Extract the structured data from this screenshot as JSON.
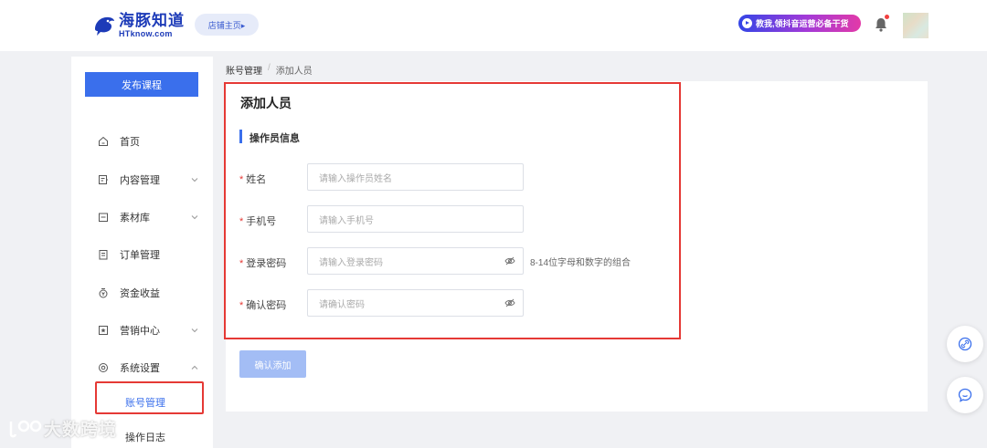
{
  "header": {
    "logo_cn": "海豚知道",
    "logo_en": "HTknow.com",
    "shop_button": "店铺主页▸",
    "promo_text": "教我,领抖音运营必备干货"
  },
  "sidebar": {
    "publish_button": "发布课程",
    "items": [
      {
        "label": "首页",
        "icon": "home-icon"
      },
      {
        "label": "内容管理",
        "icon": "content-icon"
      },
      {
        "label": "素材库",
        "icon": "folder-icon"
      },
      {
        "label": "订单管理",
        "icon": "order-icon"
      },
      {
        "label": "资金收益",
        "icon": "money-icon"
      },
      {
        "label": "营销中心",
        "icon": "star-icon"
      },
      {
        "label": "系统设置",
        "icon": "gear-icon"
      }
    ],
    "sub_items": [
      "账号管理",
      "操作日志"
    ]
  },
  "breadcrumb": {
    "parent": "账号管理",
    "separator": "/",
    "current": "添加人员"
  },
  "form": {
    "title": "添加人员",
    "section": "操作员信息",
    "fields": [
      {
        "label": "姓名",
        "placeholder": "请输入操作员姓名"
      },
      {
        "label": "手机号",
        "placeholder": "请输入手机号"
      },
      {
        "label": "登录密码",
        "placeholder": "请输入登录密码"
      },
      {
        "label": "确认密码",
        "placeholder": "请确认密码"
      }
    ],
    "password_hint": "8-14位字母和数字的组合",
    "submit": "确认添加"
  },
  "watermark": "大数跨境",
  "colors": {
    "accent": "#3a6fec",
    "highlight": "#e53935",
    "brand": "#1d3bb8"
  }
}
